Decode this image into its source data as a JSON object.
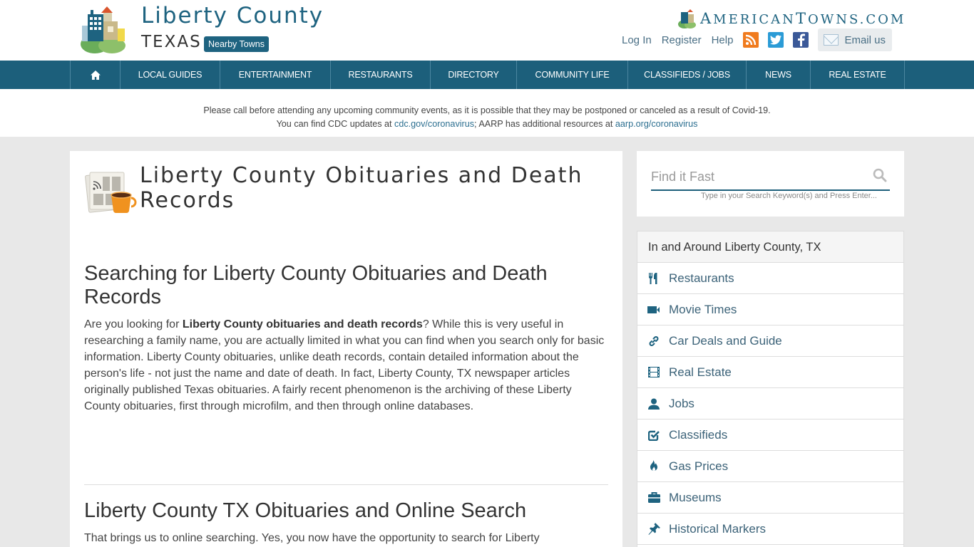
{
  "header": {
    "site_title": "Liberty County",
    "site_state": "TEXAS",
    "nearby_towns_label": "Nearby Towns",
    "brand_first_A": "A",
    "brand_rest_1": "MERICAN",
    "brand_T": "T",
    "brand_rest_2": "OWNS.COM",
    "top_links": [
      {
        "label": "Log In"
      },
      {
        "label": "Register"
      },
      {
        "label": "Help"
      }
    ],
    "social": [
      {
        "icon": "rss-icon",
        "glyph": "◉"
      },
      {
        "icon": "twitter-icon",
        "glyph": "🐦"
      },
      {
        "icon": "facebook-icon",
        "glyph": "f"
      }
    ],
    "email_label": "Email us"
  },
  "nav": {
    "home_icon": "home-icon",
    "items": [
      {
        "label": "LOCAL GUIDES"
      },
      {
        "label": "ENTERTAINMENT"
      },
      {
        "label": "RESTAURANTS"
      },
      {
        "label": "DIRECTORY"
      },
      {
        "label": "COMMUNITY LIFE"
      },
      {
        "label": "CLASSIFIEDS / JOBS"
      },
      {
        "label": "NEWS"
      },
      {
        "label": "REAL ESTATE"
      }
    ]
  },
  "notice": {
    "line1": "Please call before attending any upcoming community events, as it is possible that they may be postponed or canceled as a result of Covid-19.",
    "line2_prefix": "You can find CDC updates at ",
    "cdc_link": "cdc.gov/coronavirus",
    "line2_mid": "; AARP has additional resources at ",
    "aarp_link": "aarp.org/coronavirus"
  },
  "main": {
    "page_title": "Liberty County Obituaries and Death Records",
    "section1": {
      "heading": "Searching for Liberty County Obituaries and Death Records",
      "para_prefix": "Are you looking for ",
      "para_bold": "Liberty County obituaries and death records",
      "para_rest": "? While this is very useful in researching a family name, you are actually limited in what you can find when you search only for basic information. Liberty County obituaries, unlike death records, contain detailed information about the person's life - not just the name and date of death. In fact, Liberty County, TX newspaper articles originally published Texas obituaries. A fairly recent phenomenon is the archiving of these Liberty County obituaries, first through microfilm, and then through online databases."
    },
    "section2": {
      "heading": "Liberty County TX Obituaries and Online Search",
      "para": "That brings us to online searching. Yes, you now have the opportunity to search for Liberty"
    }
  },
  "sidebar": {
    "search": {
      "placeholder": "Find it Fast",
      "value": "",
      "hint": "Type in your Search Keyword(s) and Press Enter..."
    },
    "panel_title": "In and Around Liberty County, TX",
    "items": [
      {
        "label": "Restaurants",
        "icon": "cutlery-icon"
      },
      {
        "label": "Movie Times",
        "icon": "video-camera-icon"
      },
      {
        "label": "Car Deals and Guide",
        "icon": "link-icon"
      },
      {
        "label": "Real Estate",
        "icon": "film-icon"
      },
      {
        "label": "Jobs",
        "icon": "user-icon"
      },
      {
        "label": "Classifieds",
        "icon": "check-square-icon"
      },
      {
        "label": "Gas Prices",
        "icon": "fire-icon"
      },
      {
        "label": "Museums",
        "icon": "briefcase-icon"
      },
      {
        "label": "Historical Markers",
        "icon": "pushpin-icon"
      }
    ]
  },
  "colors": {
    "brand": "#1c5f7b",
    "link": "#2c6f90",
    "background": "#e8e8e8"
  }
}
